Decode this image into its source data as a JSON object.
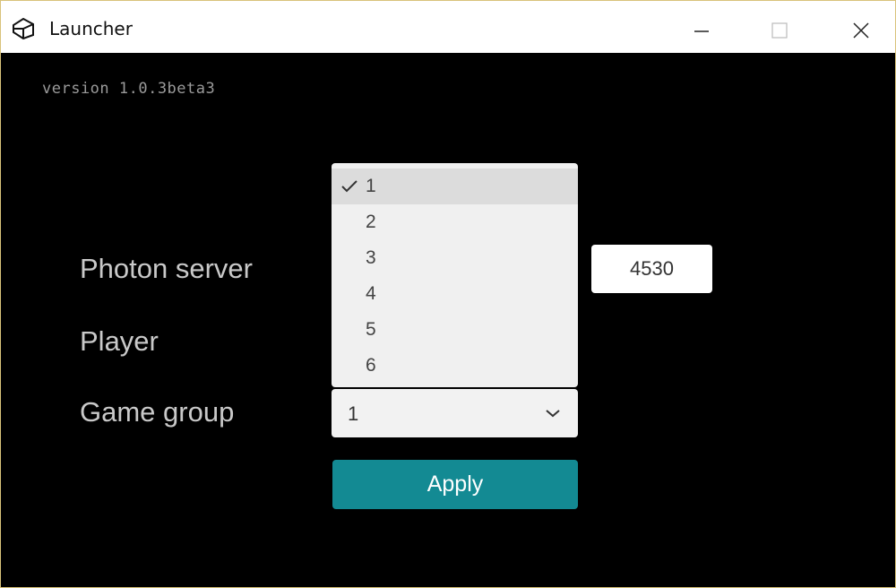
{
  "window": {
    "title": "Launcher",
    "controls": [
      "minimize",
      "maximize",
      "close"
    ]
  },
  "version_text": "version 1.0.3beta3",
  "labels": {
    "photon_server": "Photon server",
    "player": "Player",
    "game_group": "Game group"
  },
  "photon_server": {
    "port": "4530"
  },
  "game_group_dropdown": {
    "selected": "1",
    "options": [
      "1",
      "2",
      "3",
      "4",
      "5",
      "6"
    ],
    "expanded": true
  },
  "apply_button": {
    "label": "Apply"
  },
  "colors": {
    "background": "#000000",
    "apply_button": "#138a93",
    "label_text": "#c9c9c9",
    "version_text": "#9a9a9a"
  },
  "icons": {
    "app": "unity-logo-icon",
    "check": "check-icon",
    "chevron": "chevron-down-icon"
  }
}
